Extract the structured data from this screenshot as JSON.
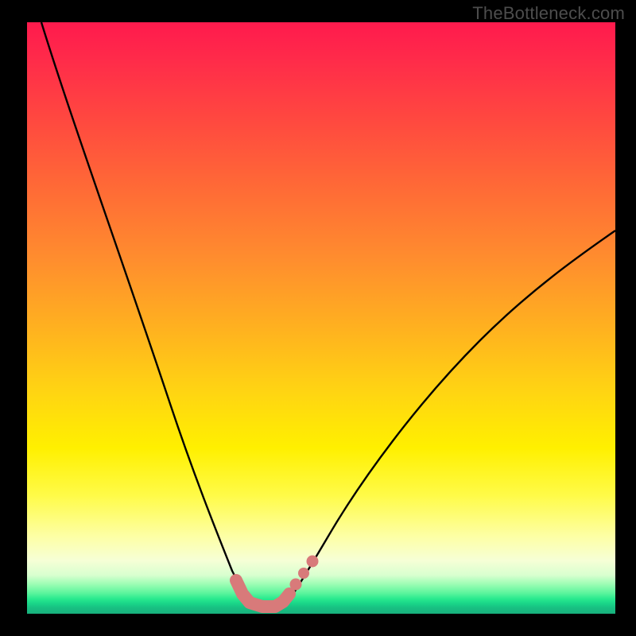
{
  "watermark": "TheBottleneck.com",
  "colors": {
    "background_frame": "#000000",
    "curve_stroke": "#000000",
    "marker": "#d87a7a",
    "gradient_top": "#ff1a4d",
    "gradient_bottom": "#18b07d"
  },
  "chart_data": {
    "type": "line",
    "title": "",
    "xlabel": "",
    "ylabel": "",
    "xlim": [
      0,
      100
    ],
    "ylim": [
      0,
      100
    ],
    "grid": false,
    "legend": false,
    "note": "V-shaped bottleneck curve on red-yellow-green gradient; y≈0 at the valley is optimal (green). Values estimated from pixel positions; no axis ticks present.",
    "series": [
      {
        "name": "left-branch",
        "x": [
          3,
          6,
          10,
          14,
          18,
          22,
          25,
          28,
          30,
          32,
          33.5,
          35,
          36,
          37,
          38
        ],
        "y": [
          100,
          86,
          70,
          56,
          44,
          33,
          25,
          18,
          13,
          9,
          6.5,
          4.5,
          3,
          2,
          1.2
        ]
      },
      {
        "name": "right-branch",
        "x": [
          44,
          45,
          46.5,
          48,
          50,
          53,
          57,
          62,
          68,
          75,
          83,
          92,
          100
        ],
        "y": [
          1.2,
          2,
          3.3,
          5,
          7.5,
          11,
          16,
          22,
          29,
          36,
          44,
          52,
          59
        ]
      },
      {
        "name": "valley-marker",
        "comment": "salmon blob indicating optimal region near the valley floor",
        "x": [
          35.5,
          36.5,
          38,
          40,
          42,
          43.5,
          44.5,
          45.5,
          47,
          48.5
        ],
        "y": [
          4.5,
          2.8,
          1.3,
          0.8,
          0.8,
          1.3,
          2.3,
          3.5,
          5.3,
          7.3
        ]
      }
    ]
  }
}
